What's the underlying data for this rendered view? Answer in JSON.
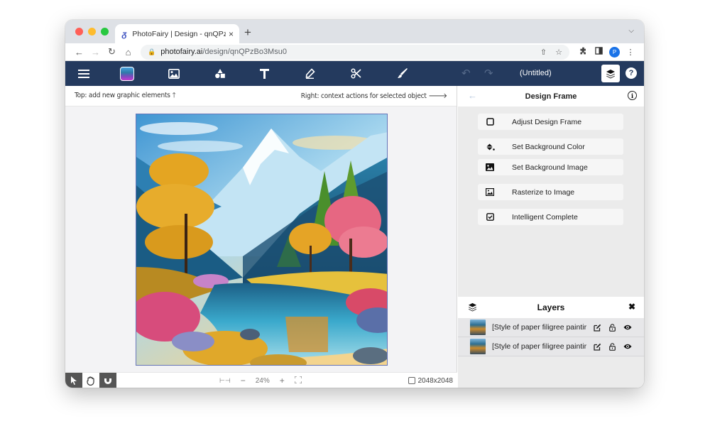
{
  "browser": {
    "tab": {
      "favicon": "photofairy-logo-icon",
      "title": "PhotoFairy | Design - qnQPzBo",
      "close_icon": "×"
    },
    "new_tab_icon": "+",
    "tab_menu_icon": "⌄",
    "nav": {
      "back": "←",
      "forward": "→",
      "reload": "↻",
      "home": "⌂"
    },
    "url": {
      "host": "photofairy.ai",
      "path": "/design/qnQPzBo3Msu0"
    },
    "omnibox_icons": {
      "share": "⇧",
      "bookmark": "☆"
    },
    "extensions": {
      "puzzle": "✱",
      "sidepanel": "◧",
      "menu": "⋮"
    },
    "profile_initial": "P"
  },
  "toolbar": {
    "tools": [
      {
        "name": "menu"
      },
      {
        "name": "app-logo"
      },
      {
        "name": "add-image"
      },
      {
        "name": "add-shapes"
      },
      {
        "name": "add-text"
      },
      {
        "name": "draw"
      },
      {
        "name": "cut"
      },
      {
        "name": "paint"
      }
    ],
    "undo_icon": "↶",
    "redo_icon": "↷",
    "document_title": "(Untitled)",
    "help_icon": "?"
  },
  "hints": {
    "left": "Top: add new graphic elements 🡑",
    "right": "Right: context actions for selected object 🡒"
  },
  "canvas": {
    "image_description": "Painting of snowy mountains, blue pine forest, orange and pink trees around a reflective lake with colorful flowers",
    "zoom_level": "24%",
    "dimensions": "2048x2048",
    "colors": {
      "sky_top": "#4f9fd8",
      "mountain": "#dff1fb",
      "forest": "#1d5b7e",
      "orange_tree": "#e9a521",
      "pink_tree": "#e8607a",
      "lake": "#3ba6c8",
      "golden_field": "#e6c13c"
    }
  },
  "bottom_bar": {
    "modes": [
      {
        "name": "select",
        "active": true
      },
      {
        "name": "pan",
        "active": false
      },
      {
        "name": "magnet",
        "active": true
      }
    ],
    "fit_icon": "⊢⊣",
    "zoom_out": "−",
    "zoom_in": "+",
    "fullscreen_icon": "⛶"
  },
  "panel": {
    "back_icon": "←",
    "title": "Design Frame",
    "info_icon": "i",
    "actions": [
      {
        "label": "Adjust Design Frame",
        "icon": "square-icon"
      },
      {
        "label": "Set Background Color",
        "icon": "paint-bucket-icon"
      },
      {
        "label": "Set Background Image",
        "icon": "image-icon"
      },
      {
        "label": "Rasterize to Image",
        "icon": "rasterize-icon"
      },
      {
        "label": "Intelligent Complete",
        "icon": "checkbox-icon"
      }
    ]
  },
  "layers": {
    "title": "Layers",
    "close_icon": "✖",
    "items": [
      {
        "name": "[Style of paper filigree paintir"
      },
      {
        "name": "[Style of paper filigree paintir"
      }
    ]
  },
  "theme": {
    "toolbar_bg": "#243a5e",
    "panel_bg": "#ebebeb",
    "accent_blue": "#1a73e8"
  }
}
